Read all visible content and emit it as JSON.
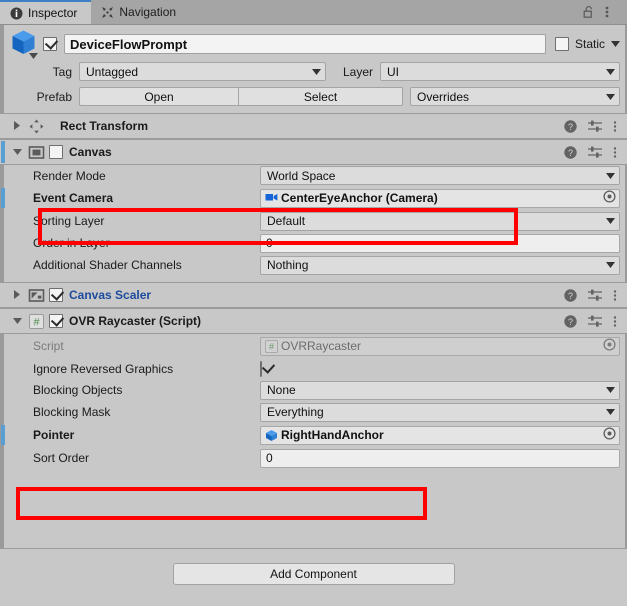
{
  "window": {
    "tabs": [
      {
        "label": "Inspector",
        "icon": "info-icon",
        "active": true
      },
      {
        "label": "Navigation",
        "icon": "navigation-icon",
        "active": false
      }
    ],
    "lock_icon": "lock-open-icon",
    "menu_icon": "kebab-menu-icon"
  },
  "object_header": {
    "icon": "prefab-cube-icon",
    "enabled_checkbox": true,
    "name": "DeviceFlowPrompt",
    "static_label": "Static",
    "static_checked": false,
    "static_dropdown_icon": "chevron-down-icon",
    "tag_label": "Tag",
    "tag_value": "Untagged",
    "layer_label": "Layer",
    "layer_value": "UI",
    "prefab_label": "Prefab",
    "prefab_open": "Open",
    "prefab_select": "Select",
    "prefab_overrides": "Overrides"
  },
  "components": [
    {
      "name": "rect-transform",
      "title": "Rect Transform",
      "icon": "rect-transform-icon",
      "expanded": false,
      "checkbox": null,
      "title_override": false,
      "header_icons": [
        "help-icon",
        "preset-icon",
        "kebab-menu-icon"
      ]
    },
    {
      "name": "canvas",
      "title": "Canvas",
      "icon": "canvas-icon",
      "expanded": true,
      "checkbox": false,
      "title_override": false,
      "header_icons": [
        "help-icon",
        "preset-icon",
        "kebab-menu-icon"
      ],
      "properties": [
        {
          "label": "Render Mode",
          "type": "popup",
          "value": "World Space"
        },
        {
          "label": "Event Camera",
          "type": "object",
          "value": "CenterEyeAnchor (Camera)",
          "icon": "camera-icon",
          "bold": true,
          "override": true,
          "highlighted": true
        },
        {
          "label": "Sorting Layer",
          "type": "popup",
          "value": "Default"
        },
        {
          "label": "Order in Layer",
          "type": "number",
          "value": "0"
        },
        {
          "label": "Additional Shader Channels",
          "type": "popup",
          "value": "Nothing"
        }
      ]
    },
    {
      "name": "canvas-scaler",
      "title": "Canvas Scaler",
      "icon": "canvas-scaler-icon",
      "expanded": false,
      "checkbox": true,
      "title_override": true,
      "header_icons": [
        "help-icon",
        "preset-icon",
        "kebab-menu-icon"
      ]
    },
    {
      "name": "ovr-raycaster",
      "title": "OVR Raycaster (Script)",
      "icon": "script-icon",
      "expanded": true,
      "checkbox": true,
      "title_override": false,
      "header_icons": [
        "help-icon",
        "preset-icon",
        "kebab-menu-icon"
      ],
      "properties": [
        {
          "label": "Script",
          "type": "object",
          "value": "OVRRaycaster",
          "icon": "script-icon",
          "dim": true
        },
        {
          "label": "Ignore Reversed Graphics",
          "type": "checkbox",
          "value": true
        },
        {
          "label": "Blocking Objects",
          "type": "popup",
          "value": "None"
        },
        {
          "label": "Blocking Mask",
          "type": "popup",
          "value": "Everything"
        },
        {
          "label": "Pointer",
          "type": "object",
          "value": "RightHandAnchor",
          "icon": "gameobject-cube-icon",
          "bold": true,
          "override": true,
          "highlighted": true,
          "short": true
        },
        {
          "label": "Sort Order",
          "type": "number",
          "value": "0"
        }
      ]
    }
  ],
  "footer": {
    "add_component_label": "Add Component"
  },
  "colors": {
    "background": "#c8c8c8",
    "accent_blue": "#3d7ec6",
    "override_marker": "#5a9fd4",
    "override_text": "#1d4b9e",
    "highlight_red": "#fe0000",
    "unity_blue_icon": "#2f6fd0",
    "script_green": "#7aa67a"
  }
}
